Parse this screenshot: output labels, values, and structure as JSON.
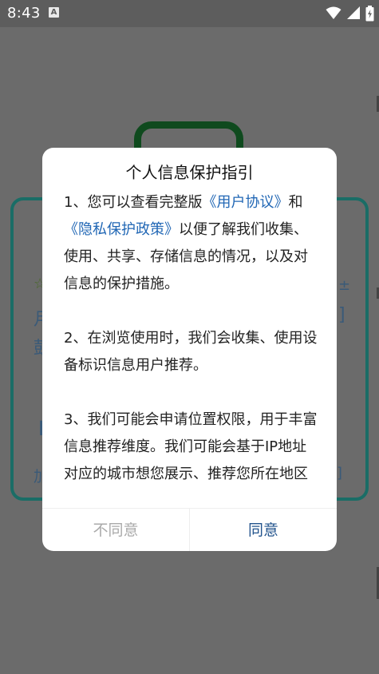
{
  "status_bar": {
    "time": "8:43",
    "notification_icon": "a-badge-icon",
    "icons": [
      "wifi-icon",
      "signal-icon",
      "battery-charging-icon"
    ]
  },
  "dialog": {
    "title": "个人信息保护指引",
    "section1": {
      "prefix": "1、您可以查看完整版",
      "user_agreement_link": "《用户协议》",
      "and": "和",
      "privacy_policy_link": "《隐私保护政策》",
      "suffix": "以便了解我们收集、使用、共享、存储信息的情况，以及对信息的保护措施。"
    },
    "section2": "2、在浏览使用时，我们会收集、使用设备标识信息用户推荐。",
    "section3": "3、我们可能会申请位置权限，用于丰富信息推荐维度。我们可能会基于IP地址对应的城市想您展示、推荐您所在地区的本地相关信息或内容，城市位置无",
    "disagree_label": "不同意",
    "agree_label": "同意"
  },
  "colors": {
    "link": "#2167b5",
    "agree": "#23548d",
    "disagree": "#aaaaaa",
    "scrim": "#6b6b6b"
  }
}
